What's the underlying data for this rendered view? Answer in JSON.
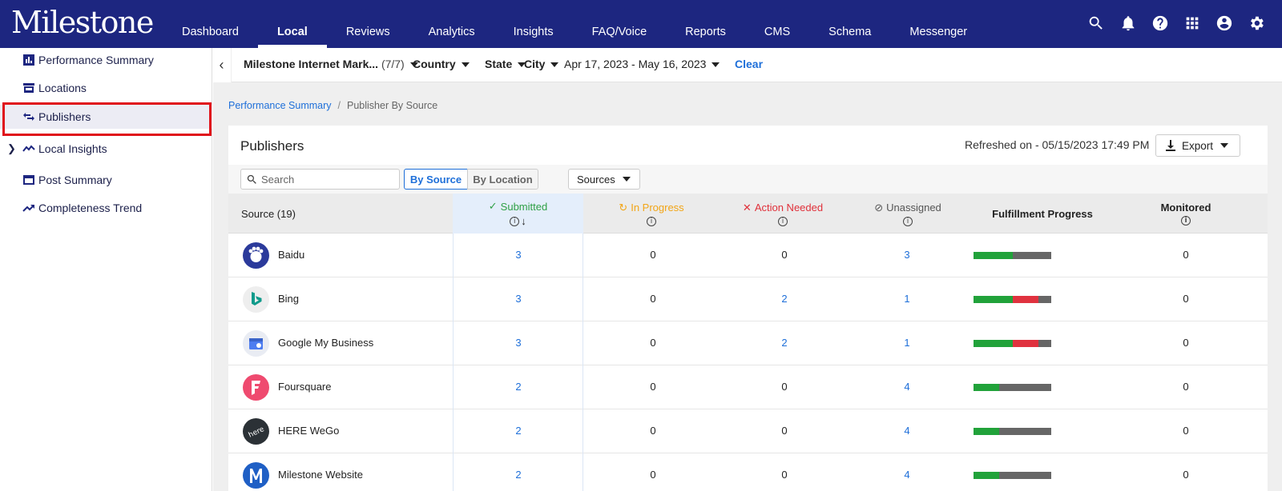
{
  "header": {
    "logo": "Milestone",
    "nav": [
      "Dashboard",
      "Local",
      "Reviews",
      "Analytics",
      "Insights",
      "FAQ/Voice",
      "Reports",
      "CMS",
      "Schema",
      "Messenger"
    ],
    "active_nav": "Local",
    "icons": [
      "search-icon",
      "bell-icon",
      "help-icon",
      "apps-grid-icon",
      "account-icon",
      "settings-icon"
    ]
  },
  "sidebar": {
    "items": [
      {
        "label": "Performance Summary",
        "icon": "bar-chart-icon"
      },
      {
        "label": "Locations",
        "icon": "store-icon"
      },
      {
        "label": "Publishers",
        "icon": "swap-arrows-icon",
        "selected": true
      },
      {
        "label": "Local Insights",
        "icon": "insights-icon",
        "expandable": true
      },
      {
        "label": "Post Summary",
        "icon": "window-icon"
      },
      {
        "label": "Completeness Trend",
        "icon": "trending-up-icon"
      }
    ]
  },
  "filters": {
    "account": "Milestone Internet Mark...",
    "account_count": "(7/7)",
    "country": "Country",
    "state": "State",
    "city": "City",
    "date_range": "Apr 17, 2023 - May 16, 2023",
    "clear": "Clear"
  },
  "breadcrumb": {
    "parent": "Performance Summary",
    "separator": "/",
    "current": "Publisher By Source"
  },
  "card": {
    "title": "Publishers",
    "refreshed": "Refreshed on - 05/15/2023 17:49 PM",
    "export_label": "Export"
  },
  "toolbar": {
    "search_placeholder": "Search",
    "by_source": "By Source",
    "by_location": "By Location",
    "sources": "Sources"
  },
  "table": {
    "headers": {
      "source": "Source (19)",
      "submitted": "Submitted",
      "in_progress": "In Progress",
      "action_needed": "Action Needed",
      "unassigned": "Unassigned",
      "fulfillment": "Fulfillment Progress",
      "monitored": "Monitored"
    },
    "rows": [
      {
        "name": "Baidu",
        "submitted": "3",
        "in_progress": "0",
        "action_needed": "0",
        "unassigned": "3",
        "monitored": "0",
        "progress": {
          "green": 0.5,
          "red": 0,
          "gray": 0.5
        }
      },
      {
        "name": "Bing",
        "submitted": "3",
        "in_progress": "0",
        "action_needed": "2",
        "unassigned": "1",
        "monitored": "0",
        "progress": {
          "green": 0.5,
          "red": 0.333,
          "gray": 0.167
        }
      },
      {
        "name": "Google My Business",
        "submitted": "3",
        "in_progress": "0",
        "action_needed": "2",
        "unassigned": "1",
        "monitored": "0",
        "progress": {
          "green": 0.5,
          "red": 0.333,
          "gray": 0.167
        }
      },
      {
        "name": "Foursquare",
        "submitted": "2",
        "in_progress": "0",
        "action_needed": "0",
        "unassigned": "4",
        "monitored": "0",
        "progress": {
          "green": 0.333,
          "red": 0,
          "gray": 0.667
        }
      },
      {
        "name": "HERE WeGo",
        "submitted": "2",
        "in_progress": "0",
        "action_needed": "0",
        "unassigned": "4",
        "monitored": "0",
        "progress": {
          "green": 0.333,
          "red": 0,
          "gray": 0.667
        }
      },
      {
        "name": "Milestone Website",
        "submitted": "2",
        "in_progress": "0",
        "action_needed": "0",
        "unassigned": "4",
        "monitored": "0",
        "progress": {
          "green": 0.333,
          "red": 0,
          "gray": 0.667
        }
      }
    ]
  },
  "colors": {
    "header_bg": "#1d2680",
    "link": "#1e6fd9",
    "submitted": "#2fa046",
    "in_progress": "#f2a516",
    "action_needed": "#e0303a",
    "progress_green": "#21a23a",
    "progress_red": "#e0323f",
    "progress_gray": "#666666",
    "highlight_box": "#e0101a"
  }
}
